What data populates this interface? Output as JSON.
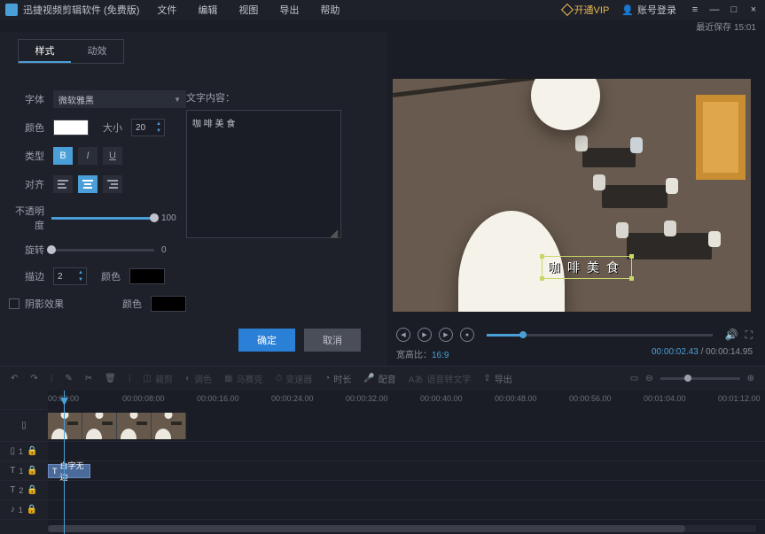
{
  "app": {
    "title": "迅捷视频剪辑软件 (免费版)"
  },
  "menu": [
    "文件",
    "编辑",
    "视图",
    "导出",
    "帮助"
  ],
  "vip": {
    "label": "开通VIP"
  },
  "login": {
    "label": "账号登录"
  },
  "lastSave": {
    "label": "最近保存",
    "time": "15:01"
  },
  "tabs": {
    "style": "样式",
    "motion": "动效"
  },
  "form": {
    "fontLabel": "字体",
    "fontValue": "微软雅黑",
    "colorLabel": "颜色",
    "sizeLabel": "大小",
    "sizeValue": "20",
    "typeLabel": "类型",
    "bold": "B",
    "italic": "I",
    "underline": "U",
    "alignLabel": "对齐",
    "opacityLabel": "不透明度",
    "opacityValue": "100",
    "rotateLabel": "旋转",
    "rotateValue": "0",
    "strokeLabel": "描边",
    "strokeValue": "2",
    "strokeColorLabel": "颜色",
    "shadowLabel": "阴影效果",
    "shadowColorLabel": "颜色",
    "contentLabel": "文字内容：",
    "contentValue": "咖 啡 美 食"
  },
  "buttons": {
    "ok": "确定",
    "cancel": "取消"
  },
  "subtitle": "咖啡美食",
  "aspect": {
    "label": "宽高比：",
    "value": "16:9"
  },
  "time": {
    "current": "00:00:02.43",
    "total": "00:00:14.95"
  },
  "toolbar": {
    "crop": "裁剪",
    "adjust": "调色",
    "mosaic": "马赛克",
    "speedChange": "变速器",
    "duration": "时长",
    "audio": "配音",
    "speech": "语音转文字",
    "export": "导出"
  },
  "ruler": [
    "00:00:00",
    "00:00:08:00",
    "00:00:16.00",
    "00:00:24.00",
    "00:00:32.00",
    "00:00:40.00",
    "00:00:48.00",
    "00:00:56.00",
    "00:01:04.00",
    "00:01:12.00"
  ],
  "tracks": {
    "pip": "1",
    "t1": "1",
    "t2": "2",
    "a1": "1",
    "textClip": "白字无边"
  }
}
